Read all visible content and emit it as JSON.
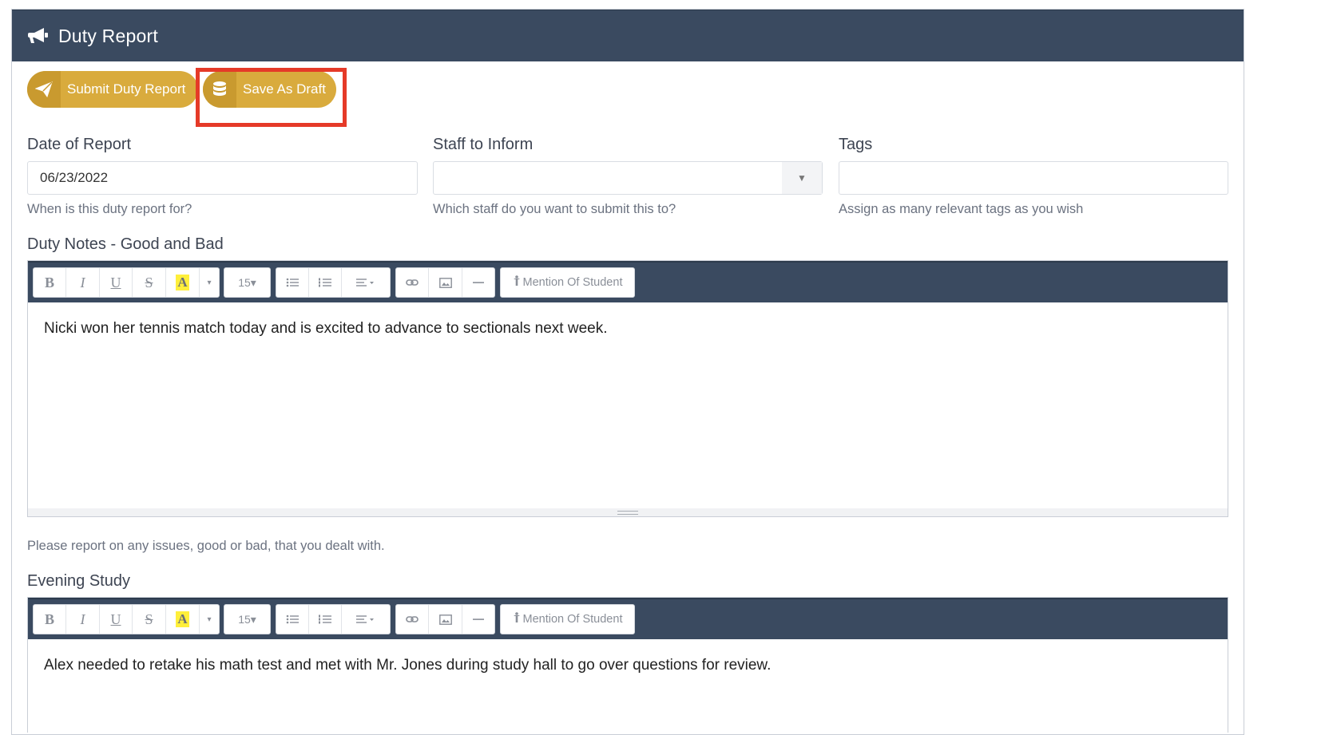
{
  "header": {
    "title": "Duty Report",
    "icon": "bullhorn-icon"
  },
  "actions": {
    "submit_label": "Submit Duty Report",
    "submit_icon": "paper-plane-icon",
    "draft_label": "Save As Draft",
    "draft_icon": "database-icon",
    "accent_color": "#d9ab3d",
    "highlight_color": "#e53a28"
  },
  "fields": {
    "date": {
      "label": "Date of Report",
      "value": "06/23/2022",
      "help": "When is this duty report for?"
    },
    "staff": {
      "label": "Staff to Inform",
      "value": "",
      "help": "Which staff do you want to submit this to?"
    },
    "tags": {
      "label": "Tags",
      "value": "",
      "help": "Assign as many relevant tags as you wish"
    }
  },
  "duty_notes": {
    "label": "Duty Notes - Good and Bad",
    "content": "Nicki won her tennis match today and is excited to advance to sectionals next week.",
    "help": "Please report on any issues, good or bad, that you dealt with."
  },
  "evening_study": {
    "label": "Evening Study",
    "content": "Alex needed to retake his math test and met with Mr. Jones during study hall to go over questions for review."
  },
  "toolbar": {
    "bold": "B",
    "italic": "I",
    "underline": "U",
    "strike": "S",
    "highlight": "A",
    "font_size": "15",
    "mention_label": "Mention Of Student"
  }
}
